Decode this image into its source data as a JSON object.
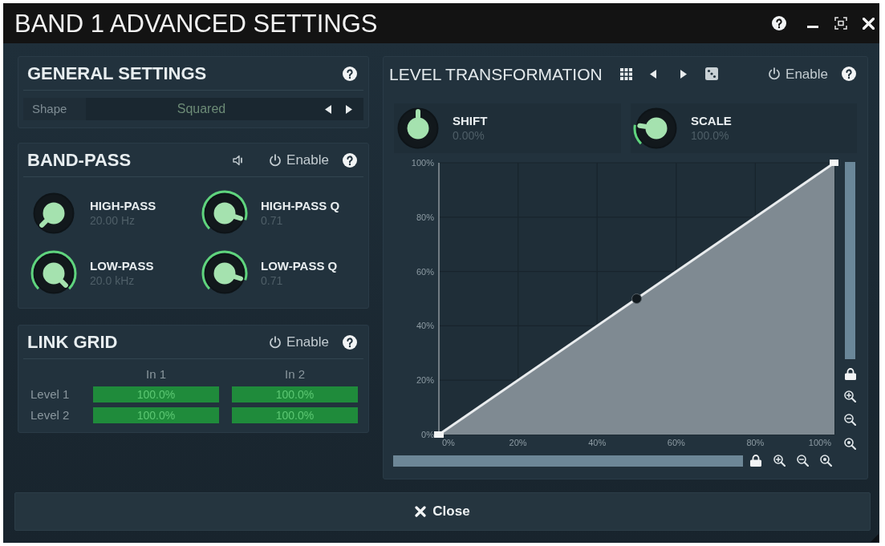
{
  "window": {
    "title": "BAND 1 ADVANCED SETTINGS"
  },
  "general_settings": {
    "title": "GENERAL SETTINGS",
    "shape": {
      "label": "Shape",
      "value": "Squared"
    }
  },
  "band_pass": {
    "title": "BAND-PASS",
    "enable": {
      "label": "Enable"
    },
    "knobs": [
      {
        "label": "HIGH-PASS",
        "value": "20.00 Hz",
        "level": 0
      },
      {
        "label": "HIGH-PASS Q",
        "value": "0.71",
        "level": 0.9
      },
      {
        "label": "LOW-PASS",
        "value": "20.0 kHz",
        "level": 1
      },
      {
        "label": "LOW-PASS Q",
        "value": "0.71",
        "level": 0.9
      }
    ]
  },
  "link_grid": {
    "title": "LINK GRID",
    "enable": {
      "label": "Enable"
    },
    "columns": [
      "In 1",
      "In 2"
    ],
    "rows": [
      {
        "label": "Level 1",
        "cells": [
          {
            "value": "100.0%",
            "level": 1
          },
          {
            "value": "100.0%",
            "level": 1
          }
        ]
      },
      {
        "label": "Level 2",
        "cells": [
          {
            "value": "100.0%",
            "level": 1
          },
          {
            "value": "100.0%",
            "level": 1
          }
        ]
      }
    ]
  },
  "level_transformation": {
    "title": "LEVEL TRANSFORMATION",
    "enable": {
      "label": "Enable"
    },
    "knobs": [
      {
        "label": "SHIFT",
        "value": "0.00%",
        "level": 0.5,
        "bipolar": true
      },
      {
        "label": "SCALE",
        "value": "100.0%",
        "level": 0.2,
        "bipolar": false
      }
    ],
    "chart_data": [
      {
        "type": "area",
        "x": [
          0,
          50,
          100
        ],
        "values": [
          0,
          50,
          100
        ],
        "color": "#7f8a92",
        "xlim": [
          0,
          100
        ],
        "ylim": [
          0,
          100
        ],
        "xticks": [
          {
            "value": 0,
            "label": "0%"
          },
          {
            "value": 20,
            "label": "20%"
          },
          {
            "value": 40,
            "label": "40%"
          },
          {
            "value": 60,
            "label": "60%"
          },
          {
            "value": 80,
            "label": "80%"
          },
          {
            "value": 100,
            "label": "100%"
          }
        ],
        "yticks": [
          {
            "value": 0,
            "label": "0%"
          },
          {
            "value": 20,
            "label": "20%"
          },
          {
            "value": 40,
            "label": "40%"
          },
          {
            "value": 60,
            "label": "60%"
          },
          {
            "value": 80,
            "label": "80%"
          },
          {
            "value": 100,
            "label": "100%"
          }
        ],
        "grid": true
      }
    ]
  },
  "close_button": {
    "label": "Close"
  }
}
